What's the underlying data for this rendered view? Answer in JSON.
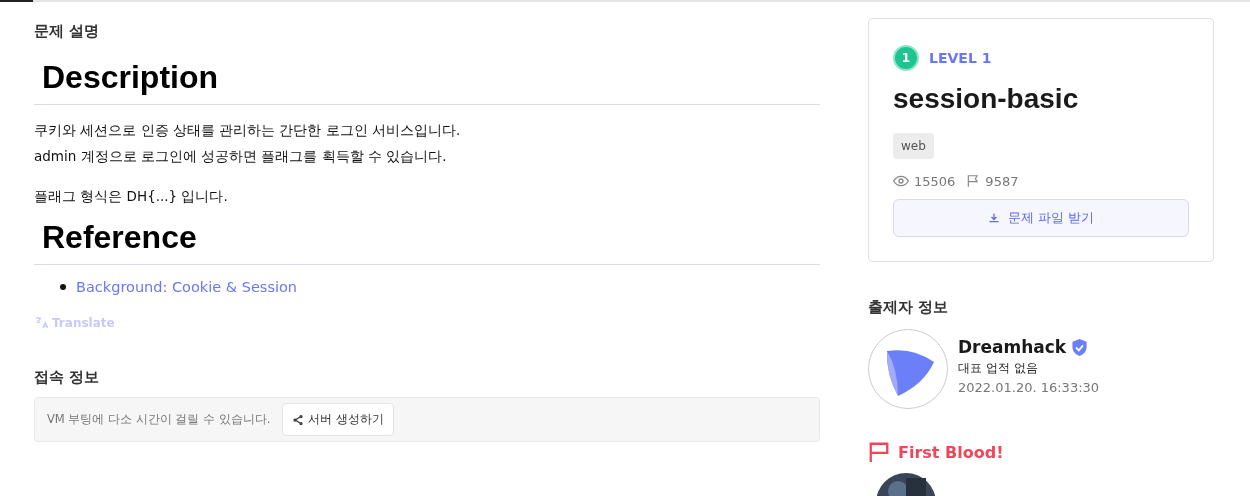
{
  "description_section": {
    "title": "문제 설명",
    "heading": "Description",
    "paragraphs": [
      "쿠키와 세션으로 인증 상태를 관리하는 간단한 로그인 서비스입니다.",
      "admin 계정으로 로그인에 성공하면 플래그를 획득할 수 있습니다."
    ],
    "note": "플래그 형식은 DH{...} 입니다."
  },
  "reference": {
    "heading": "Reference",
    "links": [
      "Background: Cookie & Session"
    ]
  },
  "translate": {
    "label": "Translate"
  },
  "connection": {
    "title": "접속 정보",
    "message": "VM 부팅에 다소 시간이 걸릴 수 있습니다.",
    "button": "서버 생성하기"
  },
  "challenge": {
    "level_number": "1",
    "level_label": "LEVEL 1",
    "name": "session-basic",
    "tags": [
      "web"
    ],
    "views": "15506",
    "solves": "9587",
    "download": "문제 파일 받기"
  },
  "author": {
    "title": "출제자 정보",
    "name": "Dreamhack",
    "verified": true,
    "achievement": "대표 업적 없음",
    "date": "2022.01.20. 16:33:30"
  },
  "first_blood": {
    "title": "First Blood!"
  }
}
